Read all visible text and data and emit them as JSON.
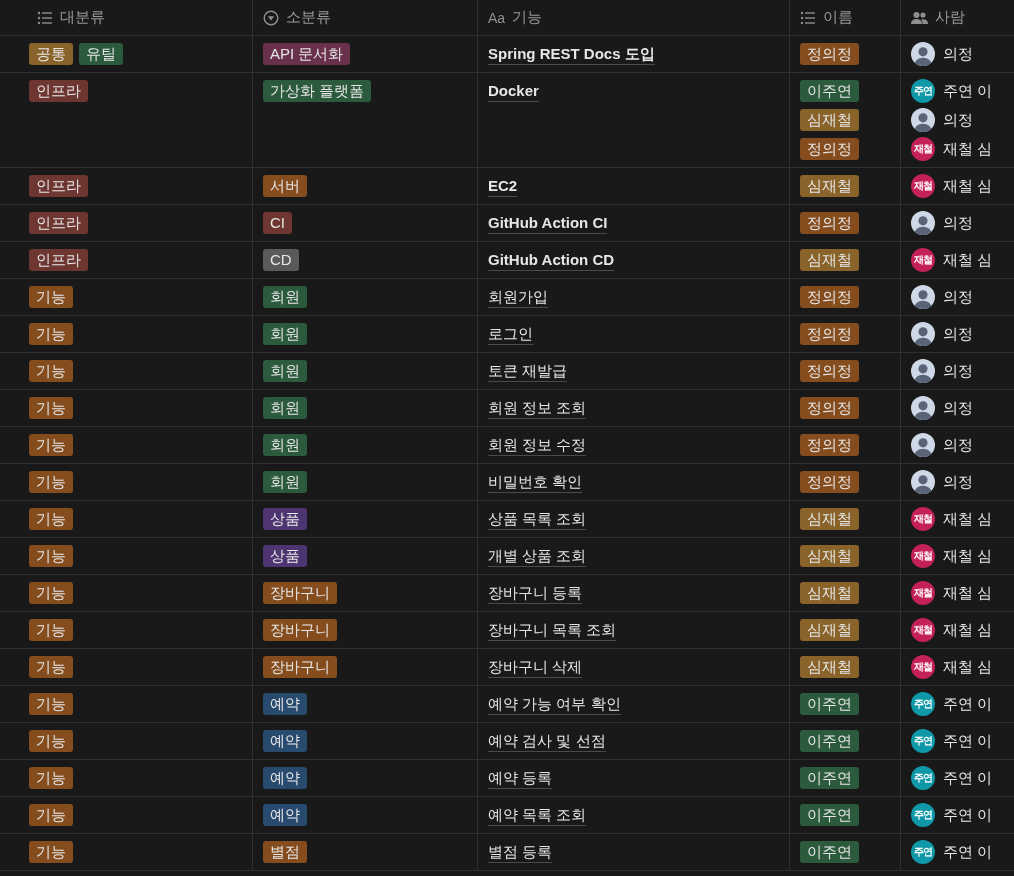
{
  "columns": [
    {
      "label": "대분류",
      "kind": "list"
    },
    {
      "label": "소분류",
      "kind": "select"
    },
    {
      "label": "기능",
      "kind": "title",
      "icon_text": "Aa"
    },
    {
      "label": "이름",
      "kind": "list"
    },
    {
      "label": "사람",
      "kind": "people"
    }
  ],
  "rows": [
    {
      "category": [
        {
          "label": "공통",
          "color": "#89632a"
        },
        {
          "label": "유틸",
          "color": "#2b5a3c"
        }
      ],
      "subcategory": [
        {
          "label": "API 문서화",
          "color": "#69314c"
        }
      ],
      "feature": {
        "text": "Spring REST Docs 도입",
        "bold": true
      },
      "names": [
        {
          "label": "정의정",
          "color": "#854c1d"
        }
      ],
      "people": [
        {
          "name": "의정",
          "kind": "photo"
        }
      ]
    },
    {
      "category": [
        {
          "label": "인프라",
          "color": "#6e3630"
        }
      ],
      "subcategory": [
        {
          "label": "가상화 플랫폼",
          "color": "#2b5a3c"
        }
      ],
      "feature": {
        "text": "Docker",
        "bold": true
      },
      "names": [
        {
          "label": "이주연",
          "color": "#2b5a3c"
        },
        {
          "label": "심재철",
          "color": "#89632a"
        },
        {
          "label": "정의정",
          "color": "#854c1d"
        }
      ],
      "people": [
        {
          "name": "주연 이",
          "kind": "initials",
          "initials": "주연",
          "color": "#0f98a8"
        },
        {
          "name": "의정",
          "kind": "photo"
        },
        {
          "name": "재철 심",
          "kind": "initials",
          "initials": "재철",
          "color": "#c4205a"
        }
      ]
    },
    {
      "category": [
        {
          "label": "인프라",
          "color": "#6e3630"
        }
      ],
      "subcategory": [
        {
          "label": "서버",
          "color": "#854c1d"
        }
      ],
      "feature": {
        "text": "EC2",
        "bold": true
      },
      "names": [
        {
          "label": "심재철",
          "color": "#89632a"
        }
      ],
      "people": [
        {
          "name": "재철 심",
          "kind": "initials",
          "initials": "재철",
          "color": "#c4205a"
        }
      ]
    },
    {
      "category": [
        {
          "label": "인프라",
          "color": "#6e3630"
        }
      ],
      "subcategory": [
        {
          "label": "CI",
          "color": "#6e3630"
        }
      ],
      "feature": {
        "text": "GitHub Action CI",
        "bold": true
      },
      "names": [
        {
          "label": "정의정",
          "color": "#854c1d"
        }
      ],
      "people": [
        {
          "name": "의정",
          "kind": "photo"
        }
      ]
    },
    {
      "category": [
        {
          "label": "인프라",
          "color": "#6e3630"
        }
      ],
      "subcategory": [
        {
          "label": "CD",
          "color": "#5a5a5a"
        }
      ],
      "feature": {
        "text": "GitHub Action CD",
        "bold": true
      },
      "names": [
        {
          "label": "심재철",
          "color": "#89632a"
        }
      ],
      "people": [
        {
          "name": "재철 심",
          "kind": "initials",
          "initials": "재철",
          "color": "#c4205a"
        }
      ]
    },
    {
      "category": [
        {
          "label": "기능",
          "color": "#854c1d"
        }
      ],
      "subcategory": [
        {
          "label": "회원",
          "color": "#2b5a3c"
        }
      ],
      "feature": {
        "text": "회원가입",
        "bold": false
      },
      "names": [
        {
          "label": "정의정",
          "color": "#854c1d"
        }
      ],
      "people": [
        {
          "name": "의정",
          "kind": "photo"
        }
      ]
    },
    {
      "category": [
        {
          "label": "기능",
          "color": "#854c1d"
        }
      ],
      "subcategory": [
        {
          "label": "회원",
          "color": "#2b5a3c"
        }
      ],
      "feature": {
        "text": "로그인",
        "bold": false
      },
      "names": [
        {
          "label": "정의정",
          "color": "#854c1d"
        }
      ],
      "people": [
        {
          "name": "의정",
          "kind": "photo"
        }
      ]
    },
    {
      "category": [
        {
          "label": "기능",
          "color": "#854c1d"
        }
      ],
      "subcategory": [
        {
          "label": "회원",
          "color": "#2b5a3c"
        }
      ],
      "feature": {
        "text": "토큰 재발급",
        "bold": false
      },
      "names": [
        {
          "label": "정의정",
          "color": "#854c1d"
        }
      ],
      "people": [
        {
          "name": "의정",
          "kind": "photo"
        }
      ]
    },
    {
      "category": [
        {
          "label": "기능",
          "color": "#854c1d"
        }
      ],
      "subcategory": [
        {
          "label": "회원",
          "color": "#2b5a3c"
        }
      ],
      "feature": {
        "text": "회원 정보 조회",
        "bold": false
      },
      "names": [
        {
          "label": "정의정",
          "color": "#854c1d"
        }
      ],
      "people": [
        {
          "name": "의정",
          "kind": "photo"
        }
      ]
    },
    {
      "category": [
        {
          "label": "기능",
          "color": "#854c1d"
        }
      ],
      "subcategory": [
        {
          "label": "회원",
          "color": "#2b5a3c"
        }
      ],
      "feature": {
        "text": "회원 정보 수정",
        "bold": false
      },
      "names": [
        {
          "label": "정의정",
          "color": "#854c1d"
        }
      ],
      "people": [
        {
          "name": "의정",
          "kind": "photo"
        }
      ]
    },
    {
      "category": [
        {
          "label": "기능",
          "color": "#854c1d"
        }
      ],
      "subcategory": [
        {
          "label": "회원",
          "color": "#2b5a3c"
        }
      ],
      "feature": {
        "text": "비밀번호 확인",
        "bold": false
      },
      "names": [
        {
          "label": "정의정",
          "color": "#854c1d"
        }
      ],
      "people": [
        {
          "name": "의정",
          "kind": "photo"
        }
      ]
    },
    {
      "category": [
        {
          "label": "기능",
          "color": "#854c1d"
        }
      ],
      "subcategory": [
        {
          "label": "상품",
          "color": "#4e3470"
        }
      ],
      "feature": {
        "text": "상품 목록 조회",
        "bold": false
      },
      "names": [
        {
          "label": "심재철",
          "color": "#89632a"
        }
      ],
      "people": [
        {
          "name": "재철 심",
          "kind": "initials",
          "initials": "재철",
          "color": "#c4205a"
        }
      ]
    },
    {
      "category": [
        {
          "label": "기능",
          "color": "#854c1d"
        }
      ],
      "subcategory": [
        {
          "label": "상품",
          "color": "#4e3470"
        }
      ],
      "feature": {
        "text": "개별 상품 조회",
        "bold": false
      },
      "names": [
        {
          "label": "심재철",
          "color": "#89632a"
        }
      ],
      "people": [
        {
          "name": "재철 심",
          "kind": "initials",
          "initials": "재철",
          "color": "#c4205a"
        }
      ]
    },
    {
      "category": [
        {
          "label": "기능",
          "color": "#854c1d"
        }
      ],
      "subcategory": [
        {
          "label": "장바구니",
          "color": "#854c1d"
        }
      ],
      "feature": {
        "text": "장바구니 등록",
        "bold": false
      },
      "names": [
        {
          "label": "심재철",
          "color": "#89632a"
        }
      ],
      "people": [
        {
          "name": "재철 심",
          "kind": "initials",
          "initials": "재철",
          "color": "#c4205a"
        }
      ]
    },
    {
      "category": [
        {
          "label": "기능",
          "color": "#854c1d"
        }
      ],
      "subcategory": [
        {
          "label": "장바구니",
          "color": "#854c1d"
        }
      ],
      "feature": {
        "text": "장바구니 목록 조회",
        "bold": false
      },
      "names": [
        {
          "label": "심재철",
          "color": "#89632a"
        }
      ],
      "people": [
        {
          "name": "재철 심",
          "kind": "initials",
          "initials": "재철",
          "color": "#c4205a"
        }
      ]
    },
    {
      "category": [
        {
          "label": "기능",
          "color": "#854c1d"
        }
      ],
      "subcategory": [
        {
          "label": "장바구니",
          "color": "#854c1d"
        }
      ],
      "feature": {
        "text": "장바구니 삭제",
        "bold": false
      },
      "names": [
        {
          "label": "심재철",
          "color": "#89632a"
        }
      ],
      "people": [
        {
          "name": "재철 심",
          "kind": "initials",
          "initials": "재철",
          "color": "#c4205a"
        }
      ]
    },
    {
      "category": [
        {
          "label": "기능",
          "color": "#854c1d"
        }
      ],
      "subcategory": [
        {
          "label": "예약",
          "color": "#284a6e"
        }
      ],
      "feature": {
        "text": "예약 가능 여부 확인",
        "bold": false
      },
      "names": [
        {
          "label": "이주연",
          "color": "#2b5a3c"
        }
      ],
      "people": [
        {
          "name": "주연 이",
          "kind": "initials",
          "initials": "주연",
          "color": "#0f98a8"
        }
      ]
    },
    {
      "category": [
        {
          "label": "기능",
          "color": "#854c1d"
        }
      ],
      "subcategory": [
        {
          "label": "예약",
          "color": "#284a6e"
        }
      ],
      "feature": {
        "text": "예약 검사 및 선점",
        "bold": false
      },
      "names": [
        {
          "label": "이주연",
          "color": "#2b5a3c"
        }
      ],
      "people": [
        {
          "name": "주연 이",
          "kind": "initials",
          "initials": "주연",
          "color": "#0f98a8"
        }
      ]
    },
    {
      "category": [
        {
          "label": "기능",
          "color": "#854c1d"
        }
      ],
      "subcategory": [
        {
          "label": "예약",
          "color": "#284a6e"
        }
      ],
      "feature": {
        "text": "예약 등록",
        "bold": false
      },
      "names": [
        {
          "label": "이주연",
          "color": "#2b5a3c"
        }
      ],
      "people": [
        {
          "name": "주연 이",
          "kind": "initials",
          "initials": "주연",
          "color": "#0f98a8"
        }
      ]
    },
    {
      "category": [
        {
          "label": "기능",
          "color": "#854c1d"
        }
      ],
      "subcategory": [
        {
          "label": "예약",
          "color": "#284a6e"
        }
      ],
      "feature": {
        "text": "예약 목록 조회",
        "bold": false
      },
      "names": [
        {
          "label": "이주연",
          "color": "#2b5a3c"
        }
      ],
      "people": [
        {
          "name": "주연 이",
          "kind": "initials",
          "initials": "주연",
          "color": "#0f98a8"
        }
      ]
    },
    {
      "category": [
        {
          "label": "기능",
          "color": "#854c1d"
        }
      ],
      "subcategory": [
        {
          "label": "별점",
          "color": "#854c1d"
        }
      ],
      "feature": {
        "text": "별점 등록",
        "bold": false
      },
      "names": [
        {
          "label": "이주연",
          "color": "#2b5a3c"
        }
      ],
      "people": [
        {
          "name": "주연 이",
          "kind": "initials",
          "initials": "주연",
          "color": "#0f98a8"
        }
      ]
    }
  ]
}
